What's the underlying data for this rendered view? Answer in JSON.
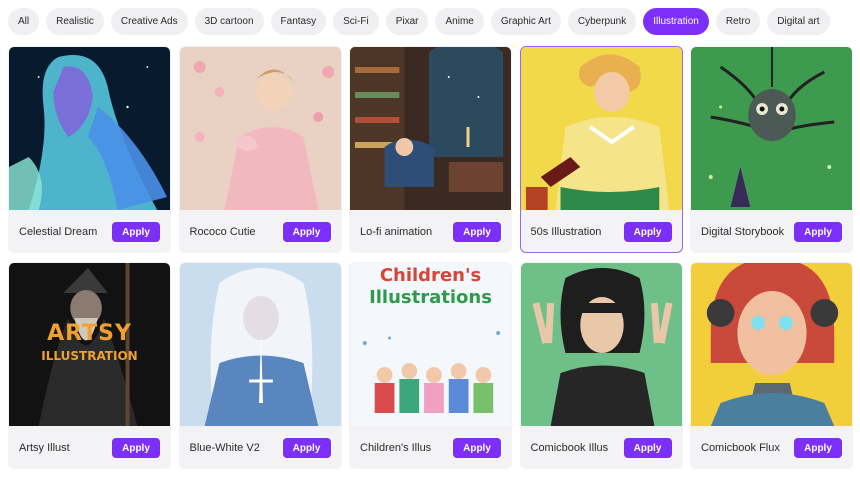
{
  "filters": [
    {
      "label": "All",
      "active": false
    },
    {
      "label": "Realistic",
      "active": false
    },
    {
      "label": "Creative Ads",
      "active": false
    },
    {
      "label": "3D cartoon",
      "active": false
    },
    {
      "label": "Fantasy",
      "active": false
    },
    {
      "label": "Sci-Fi",
      "active": false
    },
    {
      "label": "Pixar",
      "active": false
    },
    {
      "label": "Anime",
      "active": false
    },
    {
      "label": "Graphic Art",
      "active": false
    },
    {
      "label": "Cyberpunk",
      "active": false
    },
    {
      "label": "Illustration",
      "active": true
    },
    {
      "label": "Retro",
      "active": false
    },
    {
      "label": "Digital art",
      "active": false
    }
  ],
  "apply_label": "Apply",
  "styles": [
    {
      "name": "Celestial Dream",
      "selected": false
    },
    {
      "name": "Rococo Cutie",
      "selected": false
    },
    {
      "name": "Lo-fi animation",
      "selected": false
    },
    {
      "name": "50s Illustration",
      "selected": true
    },
    {
      "name": "Digital Storybook",
      "selected": false
    },
    {
      "name": "Artsy Illust",
      "selected": false,
      "thumb_text": [
        "ARTSY",
        "ILLUSTRATION"
      ]
    },
    {
      "name": "Blue-White V2",
      "selected": false
    },
    {
      "name": "Children's Illus",
      "selected": false,
      "thumb_text": [
        "Children's",
        "Illustrations"
      ]
    },
    {
      "name": "Comicbook Illus",
      "selected": false
    },
    {
      "name": "Comicbook Flux",
      "selected": false
    }
  ],
  "colors": {
    "accent": "#7b2ff7",
    "selected_border": "#9b66f0",
    "chip_bg": "#f0f0f3"
  }
}
